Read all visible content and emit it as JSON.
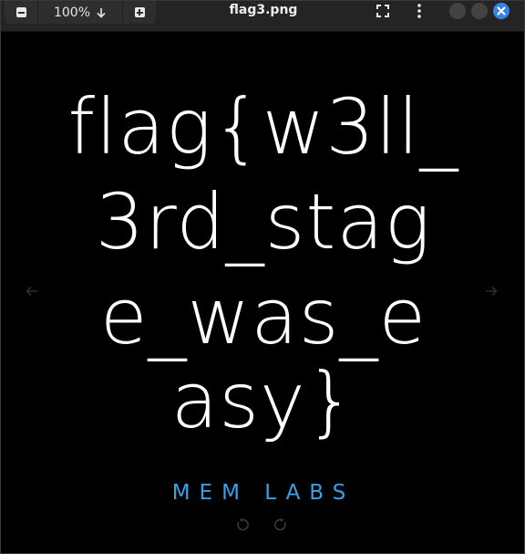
{
  "window": {
    "title": "flag3.png"
  },
  "toolbar": {
    "zoom_level": "100%"
  },
  "image": {
    "lines": [
      "flag{w3ll_",
      "3rd_stag",
      "e_was_e",
      "asy}"
    ],
    "brand": "MEM LABS"
  },
  "colors": {
    "accent": "#3584e4",
    "brand": "#3aa0e6",
    "background": "#000000",
    "headerbar": "#242424"
  },
  "icons": [
    "zoom-out-icon",
    "chevron-down-icon",
    "zoom-in-icon",
    "fullscreen-icon",
    "menu-dots-icon",
    "minimize-icon",
    "maximize-icon",
    "close-icon",
    "prev-arrow-icon",
    "next-arrow-icon",
    "rotate-left-icon",
    "rotate-right-icon"
  ]
}
